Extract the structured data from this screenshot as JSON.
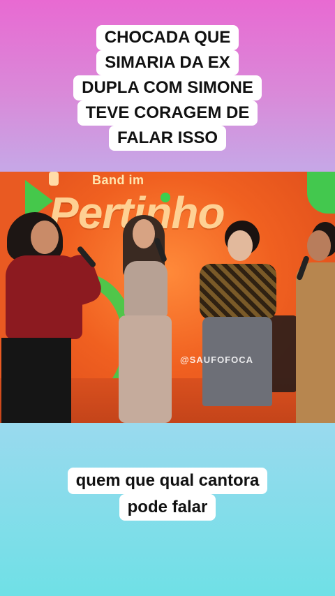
{
  "caption_top": {
    "lines": [
      "CHOCADA QUE",
      "SIMARIA DA EX",
      "DUPLA COM SIMONE",
      "TEVE CORAGEM DE",
      "FALAR ISSO"
    ]
  },
  "video": {
    "brand_small": "Band im",
    "brand_show": "Pertinho",
    "watermark": "@SAUFOFOCA"
  },
  "caption_bottom": {
    "lines": [
      "quem que qual cantora",
      "pode falar"
    ]
  },
  "colors": {
    "gradient_top": "#e86ad2",
    "gradient_bottom": "#6fe0e6",
    "stage_orange": "#f06020",
    "brand_green": "#3ccf4e",
    "caption_bg": "#ffffff",
    "caption_text": "#111111"
  }
}
